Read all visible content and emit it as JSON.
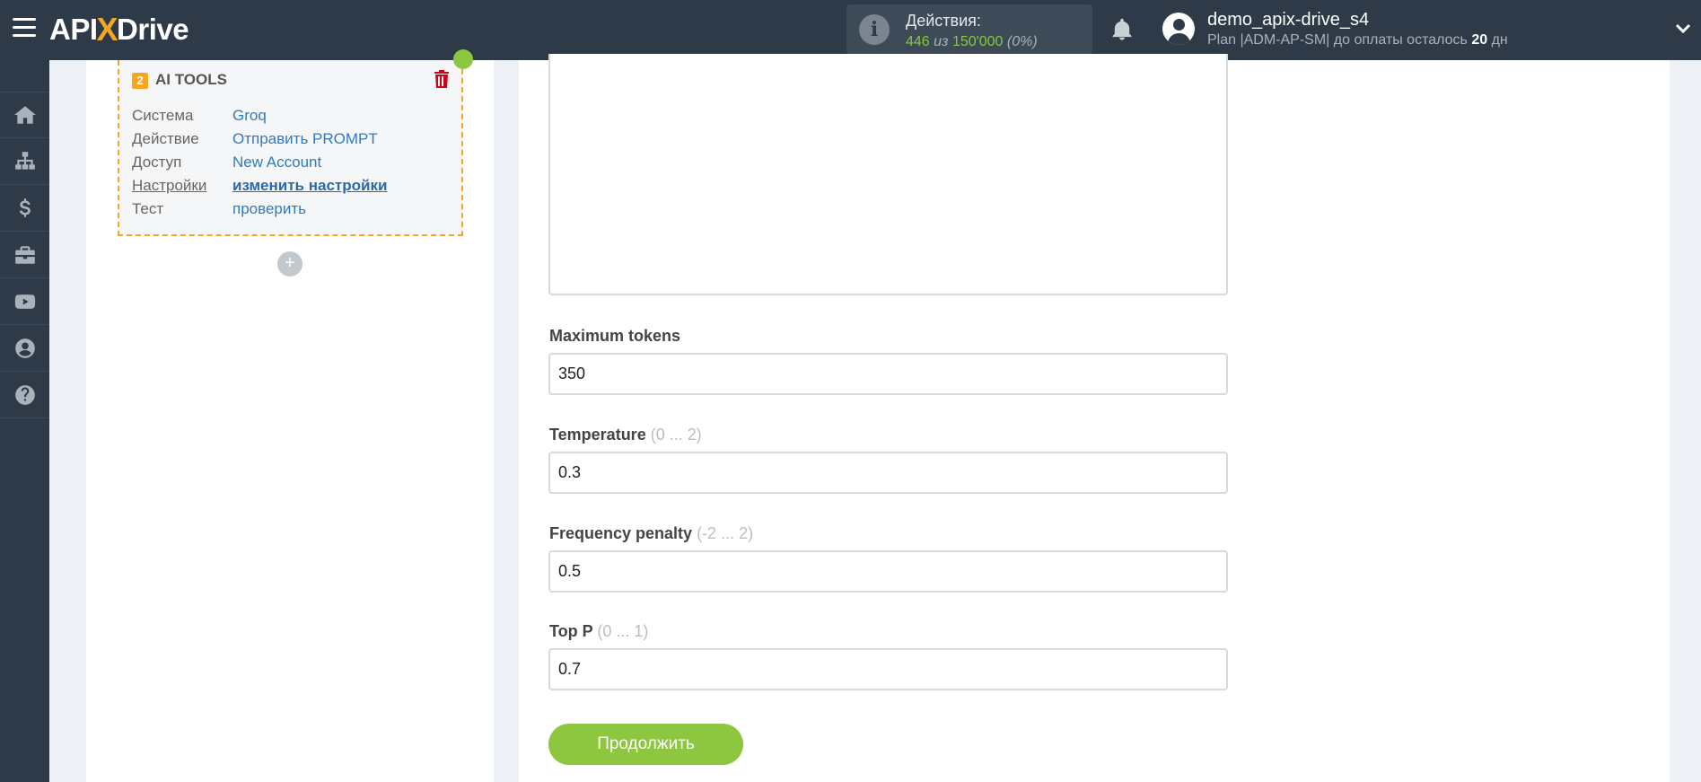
{
  "header": {
    "logo_left": "API",
    "logo_x": "X",
    "logo_right": "Drive",
    "actions_label": "Действия:",
    "actions_used": "446",
    "actions_of": "из",
    "actions_total": "150'000",
    "actions_pct": "(0%)",
    "user_name": "demo_apix-drive_s4",
    "plan_prefix": "Plan |ADM-AP-SM| до оплаты осталось",
    "plan_days": "20",
    "plan_suffix": "дн"
  },
  "sidebar": {
    "icons": [
      "home-icon",
      "sitemap-icon",
      "dollar-icon",
      "briefcase-icon",
      "youtube-icon",
      "user-icon",
      "help-icon"
    ]
  },
  "card": {
    "number": "2",
    "title": "AI TOOLS",
    "rows": [
      {
        "key": "Система",
        "value": "Groq"
      },
      {
        "key": "Действие",
        "value": "Отправить PROMPT"
      },
      {
        "key": "Доступ",
        "value": "New Account"
      },
      {
        "key": "Настройки",
        "value": "изменить настройки"
      },
      {
        "key": "Тест",
        "value": "проверить"
      }
    ],
    "add_symbol": "+"
  },
  "form": {
    "max_tokens_label": "Maximum tokens",
    "max_tokens_value": "350",
    "temperature_label": "Temperature",
    "temperature_range": "(0 ... 2)",
    "temperature_value": "0.3",
    "freq_label": "Frequency penalty",
    "freq_range": "(-2 ... 2)",
    "freq_value": "0.5",
    "topp_label": "Top P",
    "topp_range": "(0 ... 1)",
    "topp_value": "0.7",
    "continue_label": "Продолжить"
  },
  "colors": {
    "header_bg": "#2e3a48",
    "accent_green": "#8dc63f",
    "accent_orange": "#f5a623",
    "link_blue": "#2f7bbf"
  }
}
